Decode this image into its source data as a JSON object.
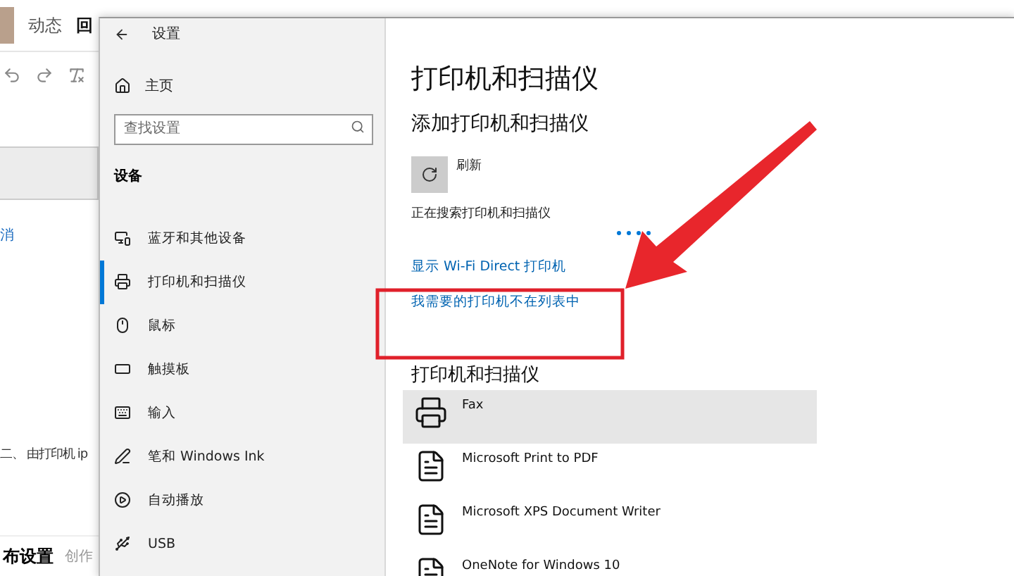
{
  "background_page": {
    "tabs": [
      {
        "label": "动态",
        "selected": false
      },
      {
        "label": "回",
        "selected": true
      }
    ],
    "link_fragment": "消",
    "body_fragment": "二、 由打印机 ip",
    "footer": {
      "title": "布设置",
      "fragment": "创作"
    }
  },
  "window": {
    "title": "设置",
    "nav": {
      "home": "主页",
      "search": {
        "placeholder": "查找设置"
      },
      "section": "设备",
      "items": [
        {
          "label": "蓝牙和其他设备",
          "kind": "devices",
          "selected": false
        },
        {
          "label": "打印机和扫描仪",
          "kind": "printer",
          "selected": true
        },
        {
          "label": "鼠标",
          "kind": "mouse",
          "selected": false
        },
        {
          "label": "触摸板",
          "kind": "touchpad",
          "selected": false
        },
        {
          "label": "输入",
          "kind": "keyboard",
          "selected": false
        },
        {
          "label": "笔和 Windows Ink",
          "kind": "pen",
          "selected": false
        },
        {
          "label": "自动播放",
          "kind": "autoplay",
          "selected": false
        },
        {
          "label": "USB",
          "kind": "usb",
          "selected": false
        }
      ]
    },
    "content": {
      "title": "打印机和扫描仪",
      "subtitle": "添加打印机和扫描仪",
      "refresh": "刷新",
      "status": "正在搜索打印机和扫描仪",
      "links": [
        "显示 Wi-Fi Direct 打印机",
        "我需要的打印机不在列表中"
      ],
      "list_heading": "打印机和扫描仪",
      "printers": [
        {
          "name": "Fax",
          "kind": "fax",
          "selected": true
        },
        {
          "name": "Microsoft Print to PDF",
          "kind": "document",
          "selected": false
        },
        {
          "name": "Microsoft XPS Document Writer",
          "kind": "document",
          "selected": false
        },
        {
          "name": "OneNote for Windows 10",
          "kind": "document",
          "selected": false
        }
      ]
    }
  }
}
